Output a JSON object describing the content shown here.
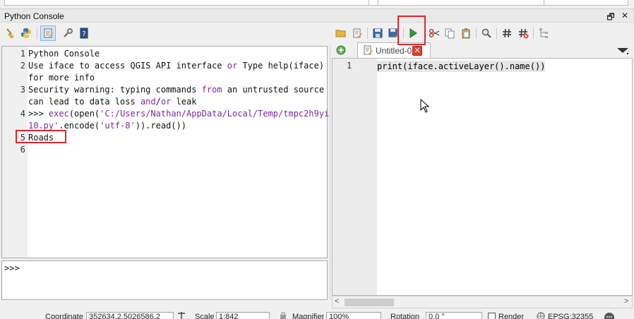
{
  "panel": {
    "title": "Python Console",
    "float_button": "🗗",
    "close_button": "✕"
  },
  "console": {
    "lines": [
      {
        "n": "1",
        "text": "Python Console"
      },
      {
        "n": "2",
        "parts": [
          "Use iface to access QGIS API interface ",
          "or",
          " Type help(iface)"
        ]
      },
      {
        "n": "",
        "text": "for more info"
      },
      {
        "n": "3",
        "parts": [
          "Security warning: typing commands ",
          "from",
          " an untrusted source"
        ]
      },
      {
        "n": "",
        "parts": [
          "can lead to data loss ",
          "and",
          "/",
          "or",
          " leak"
        ]
      },
      {
        "n": "4",
        "parts": [
          ">>> ",
          "exec",
          "(open(",
          "'C:/Users/Nathan/AppData/Local/Temp/tmpc2h9yi"
        ]
      },
      {
        "n": "",
        "parts": [
          "10.py'",
          ".encode(",
          "'utf-8'",
          ")).read())"
        ]
      },
      {
        "n": "5",
        "text": "Roads"
      },
      {
        "n": "6",
        "text": ""
      }
    ],
    "input_prompt": ">>>"
  },
  "editor": {
    "tab_label": "Untitled-0",
    "tab_close": "✕",
    "line_number": "1",
    "code": "print(iface.activeLayer().name())"
  },
  "scrollbar": {
    "left_arrow": "<",
    "right_arrow": ">"
  },
  "statusbar": {
    "coordinate_label": "Coordinate",
    "coordinate_value": "352634.2,5026586.2",
    "scale_label": "Scale",
    "scale_value": "1:842",
    "magnifier_label": "Magnifier",
    "magnifier_value": "100%",
    "rotation_label": "Rotation",
    "rotation_value": "0.0 °",
    "render_label": "Render",
    "crs_label": "EPSG:32355"
  },
  "colors": {
    "highlight": "#e0262c",
    "keyword": "#7a2aa3",
    "run_green": "#2e9e3a"
  }
}
